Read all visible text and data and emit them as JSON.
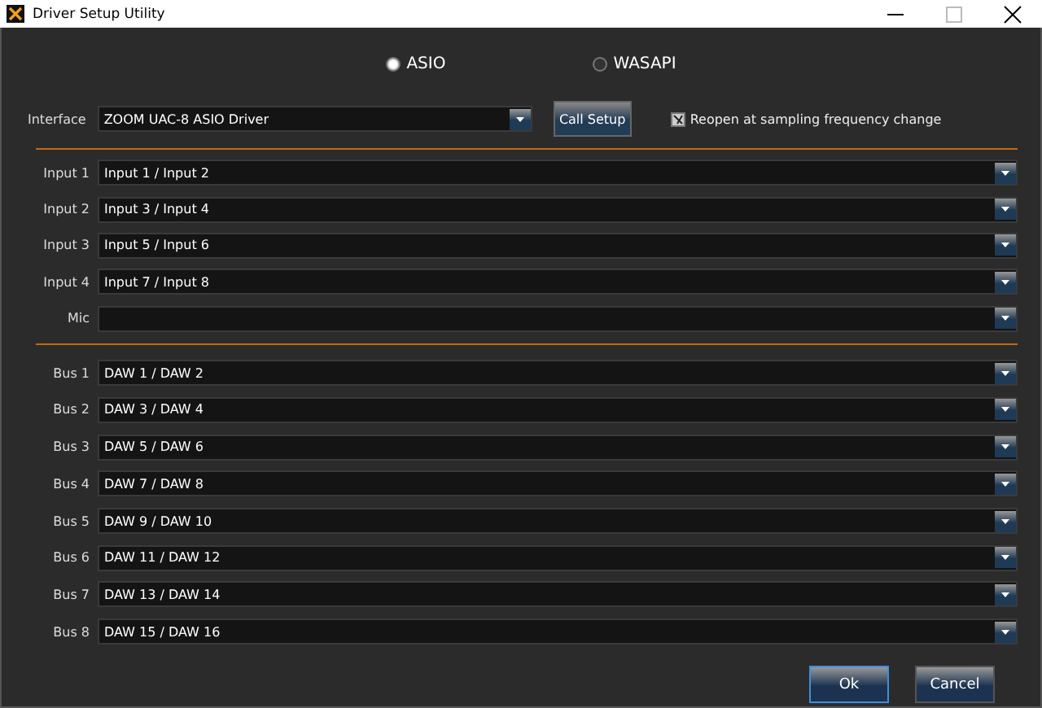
{
  "window": {
    "title": "Driver Setup Utility"
  },
  "modes": [
    {
      "label": "ASIO",
      "selected": true
    },
    {
      "label": "WASAPI",
      "selected": false
    }
  ],
  "interface": {
    "label": "Interface",
    "value": "ZOOM UAC-8 ASIO Driver",
    "button": "Call Setup",
    "option": {
      "label": "Reopen at sampling frequency change",
      "checked": true
    }
  },
  "inputs": [
    {
      "label": "Input 1",
      "value": "Input 1 / Input 2"
    },
    {
      "label": "Input 2",
      "value": "Input 3 / Input 4"
    },
    {
      "label": "Input 3",
      "value": "Input 5 / Input 6"
    },
    {
      "label": "Input 4",
      "value": "Input 7 / Input 8"
    },
    {
      "label": "Mic"
    }
  ],
  "buses": [
    {
      "label": "Bus 1",
      "value": "DAW 1 / DAW 2"
    },
    {
      "label": "Bus 2",
      "value": "DAW 3 / DAW 4"
    },
    {
      "label": "Bus 3",
      "value": "DAW 5 / DAW 6"
    },
    {
      "label": "Bus 4",
      "value": "DAW 7 / DAW 8"
    },
    {
      "label": "Bus 5",
      "value": "DAW 9 / DAW 10"
    },
    {
      "label": "Bus 6",
      "value": "DAW 11 / DAW 12"
    },
    {
      "label": "Bus 7",
      "value": "DAW 13 / DAW 14"
    },
    {
      "label": "Bus 8",
      "value": "DAW 15 / DAW 16"
    }
  ],
  "buttons": [
    {
      "label": "Ok",
      "focused": true
    },
    {
      "label": "Cancel",
      "focused": false
    }
  ]
}
